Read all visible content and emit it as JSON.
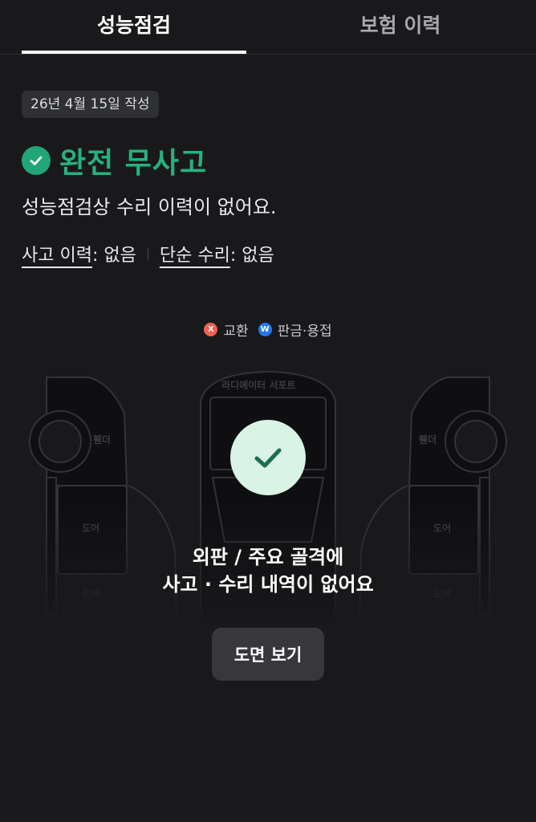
{
  "tabs": [
    {
      "label": "성능점검",
      "active": true
    },
    {
      "label": "보험 이력",
      "active": false
    }
  ],
  "report": {
    "date_label": "26년 4월 15일 작성",
    "status_title": "완전 무사고",
    "status_color": "#25b27e",
    "description": "성능점검상 수리 이력이 없어요.",
    "accident_label": "사고 이력",
    "accident_value": ": 없음",
    "repair_label": "단순 수리",
    "repair_value": ": 없음"
  },
  "legend": [
    {
      "badge": "X",
      "label": "교환",
      "color": "#f0604d"
    },
    {
      "badge": "W",
      "label": "판금·용접",
      "color": "#2478e8"
    }
  ],
  "diagram": {
    "labels": {
      "radiator": "라디에이터 서포트",
      "fender_left": "휀더",
      "fender_right": "휀더",
      "door_left": "도어",
      "door_right": "도어",
      "door_left2": "도어",
      "door_right2": "도어",
      "side_left": "사이드실",
      "side_right": "사이드실"
    },
    "message_line1": "외판 / 주요 골격에",
    "message_line2": "사고 · 수리 내역이 없어요"
  },
  "actions": {
    "view_diagram": "도면 보기"
  },
  "icons": {
    "status": "check-circle-icon",
    "overlay": "check-icon"
  }
}
